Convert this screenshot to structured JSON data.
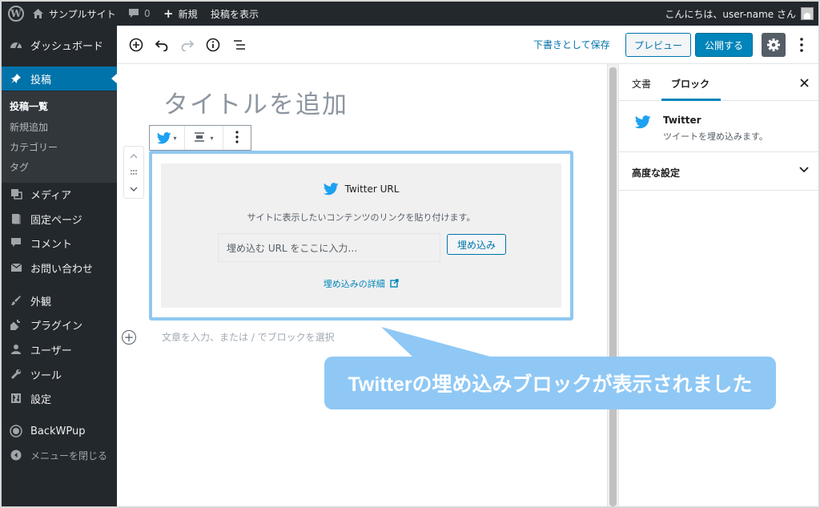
{
  "admin_bar": {
    "site_name": "サンプルサイト",
    "comments_count": "0",
    "new_label": "新規",
    "view_post_label": "投稿を表示",
    "greeting": "こんにちは、user-name さん"
  },
  "sidebar": {
    "dashboard": "ダッシュボード",
    "posts": "投稿",
    "submenu": {
      "all_posts": "投稿一覧",
      "add_new": "新規追加",
      "categories": "カテゴリー",
      "tags": "タグ"
    },
    "media": "メディア",
    "pages": "固定ページ",
    "comments": "コメント",
    "contact": "お問い合わせ",
    "appearance": "外観",
    "plugins": "プラグイン",
    "users": "ユーザー",
    "tools": "ツール",
    "settings": "設定",
    "backwpup": "BackWPup",
    "collapse": "メニューを閉じる"
  },
  "toolbar": {
    "save_draft": "下書きとして保存",
    "preview": "プレビュー",
    "publish": "公開する"
  },
  "editor": {
    "title_placeholder": "タイトルを追加",
    "embed": {
      "label": "Twitter URL",
      "instructions": "サイトに表示したいコンテンツのリンクを貼り付けます。",
      "input_placeholder": "埋め込む URL をここに入力…",
      "button": "埋め込み",
      "learn_more": "埋め込みの詳細"
    },
    "paragraph_placeholder": "文章を入力、または / でブロックを選択"
  },
  "settings_sidebar": {
    "tab_document": "文書",
    "tab_block": "ブロック",
    "block_title": "Twitter",
    "block_description": "ツイートを埋め込みます。",
    "advanced": "高度な設定"
  },
  "callout": {
    "text": "Twitterの埋め込みブロックが表示されました"
  },
  "colors": {
    "admin_bg": "#23282d",
    "accent": "#0073aa",
    "twitter": "#1da1f2",
    "callout": "#8fc8f5"
  },
  "icons": [
    "wordpress-icon",
    "home-icon",
    "comment-icon",
    "plus-icon",
    "avatar-icon",
    "dashboard-icon",
    "pin-icon",
    "media-icon",
    "page-icon",
    "contact-icon",
    "brush-icon",
    "plugin-icon",
    "user-icon",
    "wrench-icon",
    "settings-icon",
    "backwpup-icon",
    "collapse-icon",
    "add-block-icon",
    "undo-icon",
    "redo-icon",
    "info-icon",
    "outline-icon",
    "gear-icon",
    "kebab-icon",
    "twitter-icon",
    "align-icon",
    "drag-icon",
    "chevron-up-icon",
    "chevron-down-icon",
    "external-link-icon",
    "close-icon"
  ]
}
